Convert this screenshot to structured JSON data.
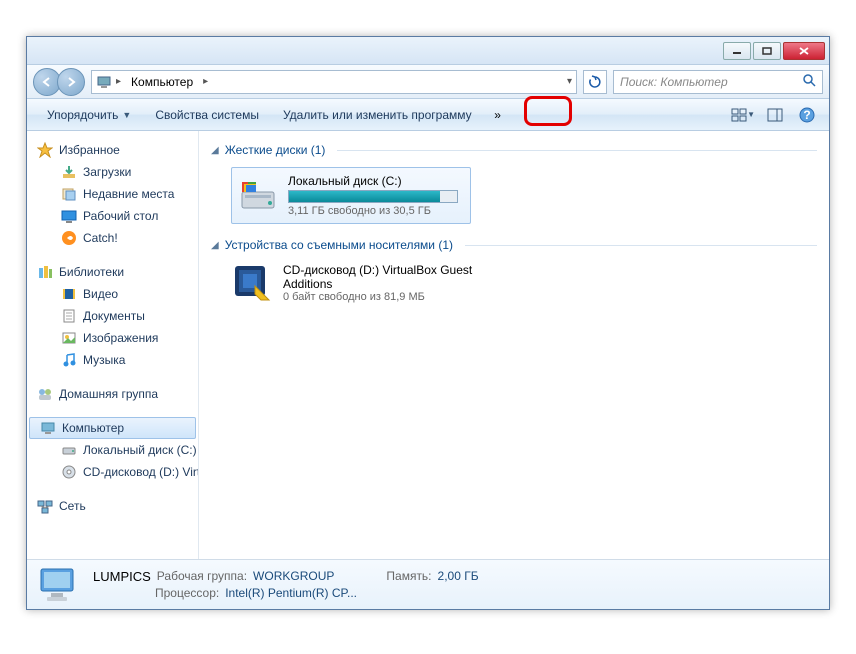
{
  "titlebar": {},
  "address": {
    "root_label": "Компьютер",
    "search_placeholder": "Поиск: Компьютер"
  },
  "toolbar": {
    "organize": "Упорядочить",
    "system_props": "Свойства системы",
    "uninstall": "Удалить или изменить программу",
    "overflow": "»"
  },
  "sidebar": {
    "favorites": {
      "label": "Избранное",
      "items": [
        "Загрузки",
        "Недавние места",
        "Рабочий стол",
        "Catch!"
      ]
    },
    "libraries": {
      "label": "Библиотеки",
      "items": [
        "Видео",
        "Документы",
        "Изображения",
        "Музыка"
      ]
    },
    "homegroup": {
      "label": "Домашняя группа"
    },
    "computer": {
      "label": "Компьютер",
      "items": [
        "Локальный диск (C:)",
        "CD-дисковод (D:) VirtualBox Guest Additions"
      ]
    },
    "network": {
      "label": "Сеть"
    }
  },
  "content": {
    "cat1": {
      "label": "Жесткие диски (1)"
    },
    "drive": {
      "name": "Локальный диск (C:)",
      "free_text": "3,11 ГБ свободно из 30,5 ГБ",
      "fill_percent": 90
    },
    "cat2": {
      "label": "Устройства со съемными носителями (1)"
    },
    "device": {
      "name": "CD-дисковод (D:) VirtualBox Guest Additions",
      "free_text": "0 байт свободно из 81,9 МБ"
    }
  },
  "status": {
    "name": "LUMPICS",
    "workgroup_lbl": "Рабочая группа:",
    "workgroup": "WORKGROUP",
    "memory_lbl": "Память:",
    "memory": "2,00 ГБ",
    "cpu_lbl": "Процессор:",
    "cpu": "Intel(R) Pentium(R) CP..."
  }
}
